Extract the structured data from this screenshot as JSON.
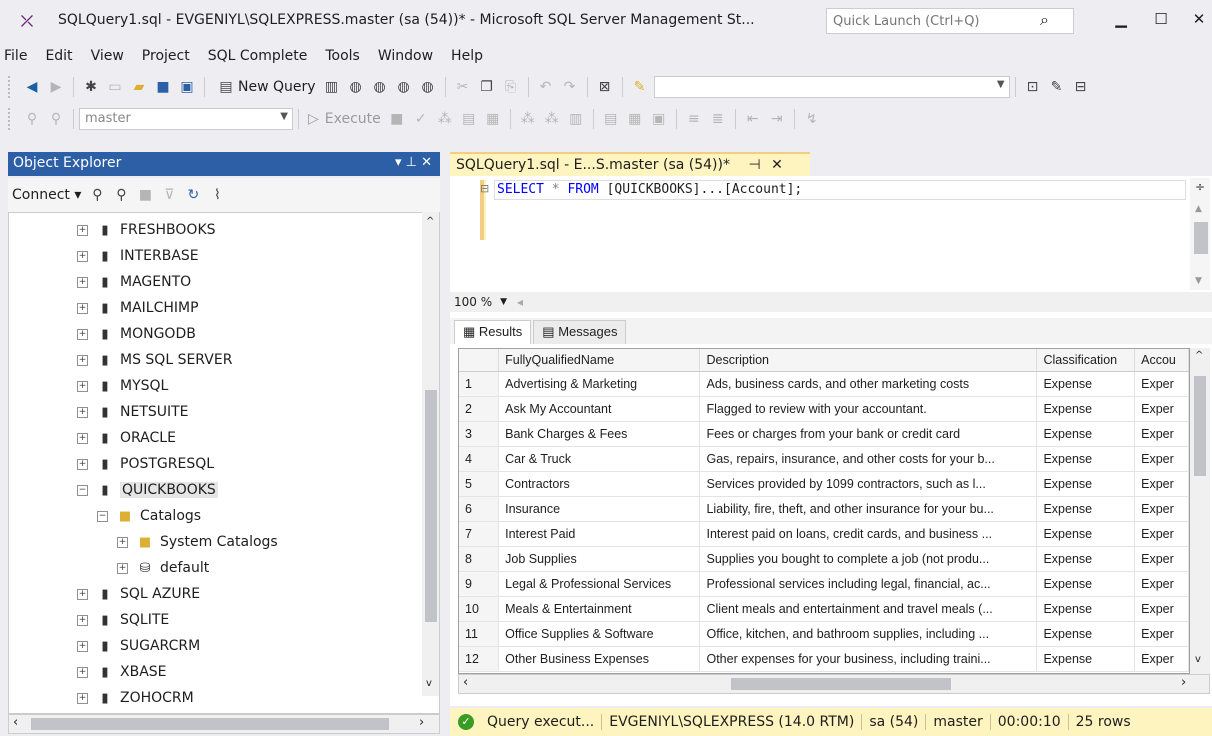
{
  "window": {
    "title": "SQLQuery1.sql - EVGENIYL\\SQLEXPRESS.master (sa (54))* - Microsoft SQL Server Management St...",
    "quick_launch_placeholder": "Quick Launch (Ctrl+Q)"
  },
  "menu": [
    "File",
    "Edit",
    "View",
    "Project",
    "SQL Complete",
    "Tools",
    "Window",
    "Help"
  ],
  "toolbar": {
    "new_query_label": "New Query",
    "database_combo": "master",
    "execute_label": "Execute"
  },
  "object_explorer": {
    "title": "Object Explorer",
    "connect_label": "Connect",
    "tree": [
      {
        "label": "FRESHBOOKS",
        "type": "server",
        "level": 1,
        "state": "collapsed"
      },
      {
        "label": "INTERBASE",
        "type": "server",
        "level": 1,
        "state": "collapsed"
      },
      {
        "label": "MAGENTO",
        "type": "server",
        "level": 1,
        "state": "collapsed"
      },
      {
        "label": "MAILCHIMP",
        "type": "server",
        "level": 1,
        "state": "collapsed"
      },
      {
        "label": "MONGODB",
        "type": "server",
        "level": 1,
        "state": "collapsed"
      },
      {
        "label": "MS SQL SERVER",
        "type": "server",
        "level": 1,
        "state": "collapsed"
      },
      {
        "label": "MYSQL",
        "type": "server",
        "level": 1,
        "state": "collapsed"
      },
      {
        "label": "NETSUITE",
        "type": "server",
        "level": 1,
        "state": "collapsed"
      },
      {
        "label": "ORACLE",
        "type": "server",
        "level": 1,
        "state": "collapsed"
      },
      {
        "label": "POSTGRESQL",
        "type": "server",
        "level": 1,
        "state": "collapsed"
      },
      {
        "label": "QUICKBOOKS",
        "type": "server",
        "level": 1,
        "state": "expanded",
        "selected": true
      },
      {
        "label": "Catalogs",
        "type": "folder",
        "level": 2,
        "state": "expanded"
      },
      {
        "label": "System Catalogs",
        "type": "folder",
        "level": 3,
        "state": "collapsed"
      },
      {
        "label": "default",
        "type": "database",
        "level": 3,
        "state": "collapsed"
      },
      {
        "label": "SQL AZURE",
        "type": "server",
        "level": 1,
        "state": "collapsed"
      },
      {
        "label": "SQLITE",
        "type": "server",
        "level": 1,
        "state": "collapsed"
      },
      {
        "label": "SUGARCRM",
        "type": "server",
        "level": 1,
        "state": "collapsed"
      },
      {
        "label": "XBASE",
        "type": "server",
        "level": 1,
        "state": "collapsed"
      },
      {
        "label": "ZOHOCRM",
        "type": "server",
        "level": 1,
        "state": "collapsed"
      }
    ]
  },
  "editor": {
    "tab_label": "SQLQuery1.sql - E...S.master (sa (54))*",
    "query": {
      "kw1": "SELECT",
      "star": "*",
      "kw2": "FROM",
      "target": "[QUICKBOOKS]...[Account];"
    },
    "zoom": "100 %"
  },
  "results": {
    "tabs": [
      "Results",
      "Messages"
    ],
    "columns": [
      "",
      "FullyQualifiedName",
      "Description",
      "Classification",
      "Accou"
    ],
    "rows": [
      [
        "1",
        "Advertising & Marketing",
        "Ads, business cards, and other marketing costs",
        "Expense",
        "Exper"
      ],
      [
        "2",
        "Ask My Accountant",
        "Flagged to review with your accountant.",
        "Expense",
        "Exper"
      ],
      [
        "3",
        "Bank Charges & Fees",
        "Fees or charges from your bank or credit card",
        "Expense",
        "Exper"
      ],
      [
        "4",
        "Car & Truck",
        "Gas, repairs, insurance, and other costs for your b...",
        "Expense",
        "Exper"
      ],
      [
        "5",
        "Contractors",
        "Services provided by 1099 contractors, such as l...",
        "Expense",
        "Exper"
      ],
      [
        "6",
        "Insurance",
        "Liability, fire, theft, and other insurance for your bu...",
        "Expense",
        "Exper"
      ],
      [
        "7",
        "Interest Paid",
        "Interest paid on loans, credit cards, and business ...",
        "Expense",
        "Exper"
      ],
      [
        "8",
        "Job Supplies",
        "Supplies you bought to complete a job (not produ...",
        "Expense",
        "Exper"
      ],
      [
        "9",
        "Legal & Professional Services",
        "Professional services including legal, financial, ac...",
        "Expense",
        "Exper"
      ],
      [
        "10",
        "Meals & Entertainment",
        "Client meals and entertainment and travel meals (...",
        "Expense",
        "Exper"
      ],
      [
        "11",
        "Office Supplies & Software",
        "Office, kitchen, and bathroom supplies, including ...",
        "Expense",
        "Exper"
      ],
      [
        "12",
        "Other Business Expenses",
        "Other expenses for your business, including traini...",
        "Expense",
        "Exper"
      ]
    ]
  },
  "status": {
    "message": "Query execut...",
    "server": "EVGENIYL\\SQLEXPRESS (14.0 RTM)",
    "user": "sa (54)",
    "database": "master",
    "elapsed": "00:00:10",
    "rows": "25 rows"
  }
}
